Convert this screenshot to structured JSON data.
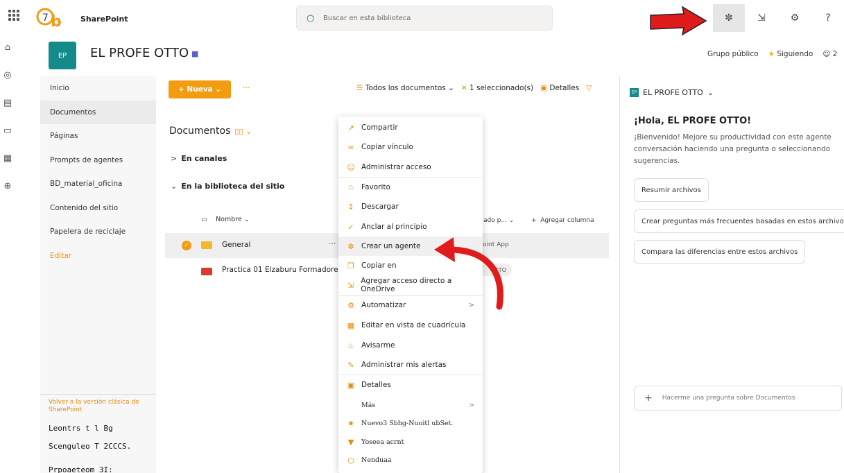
{
  "app": {
    "name": "SharePoint"
  },
  "search": {
    "placeholder": "Buscar en esta biblioteca"
  },
  "topbar": {
    "icons": [
      "copilot-icon",
      "share-icon",
      "settings-icon",
      "help-icon"
    ],
    "help_glyph": "?",
    "trail": "a1"
  },
  "site": {
    "avatar": "EP",
    "title": "EL PROFE OTTO",
    "visibility": "Grupo público",
    "following": "Siguiendo",
    "members": "2"
  },
  "nav": {
    "items": [
      "Inicio",
      "Documentos",
      "Páginas",
      "Prompts de agentes",
      "BD_material_oficina",
      "Contenido del sitio",
      "Papelera de reciclaje"
    ],
    "edit": "Editar",
    "classic": "Volver a la versión clásica de SharePoint",
    "garbled": [
      "Leontrs t l Bg",
      "Scenguleo T 2CCCS.",
      "Prpoaeteom 3I:"
    ]
  },
  "commandbar": {
    "new": "Nueva",
    "view": "Todos los documentos",
    "selected": "1 seleccionado(s)",
    "details": "Detalles"
  },
  "library": {
    "title": "Documentos",
    "group1": "En canales",
    "group2": "En la biblioteca del sitio",
    "col_name": "Nombre",
    "col_modified": "ado p...",
    "col_add": "Agregar columna",
    "rows": [
      {
        "name": "General",
        "modified_by": "oint App"
      },
      {
        "name": "Practica 01 Elzaburu Formadores IT",
        "modified_by": "OTTO"
      }
    ]
  },
  "menu": {
    "items": [
      "Compartir",
      "Copiar vínculo",
      "Administrar acceso",
      "Favorito",
      "Descargar",
      "Anclar al principio",
      "Crear un agente",
      "Copiar en",
      "Agregar acceso directo a OneDrive",
      "Automatizar",
      "Editar en vista de cuadrícula",
      "Avisarme",
      "Administrar mis alertas",
      "Detalles",
      "Más",
      "Nuevo3 Sbhg-Nuoitl ubSet.",
      "Yoseea acrnt",
      "Nenduaa"
    ]
  },
  "panel": {
    "site": "EL PROFE OTTO",
    "hello": "¡Hola, EL PROFE OTTO!",
    "intro": [
      "¡Bienvenido! Mejore su productividad con este agente",
      "conversación haciendo una pregunta o seleccionando",
      "sugerencias."
    ],
    "suggestions": [
      "Resumir archivos",
      "Crear preguntas más frecuentes basadas en estos archivos",
      "Compara las diferencias entre estos archivos"
    ],
    "ask_placeholder": "Hacerme una pregunta sobre Documentos"
  },
  "colors": {
    "accent": "#f39c12",
    "site": "#148a8a",
    "arrow": "#e01b1b"
  }
}
